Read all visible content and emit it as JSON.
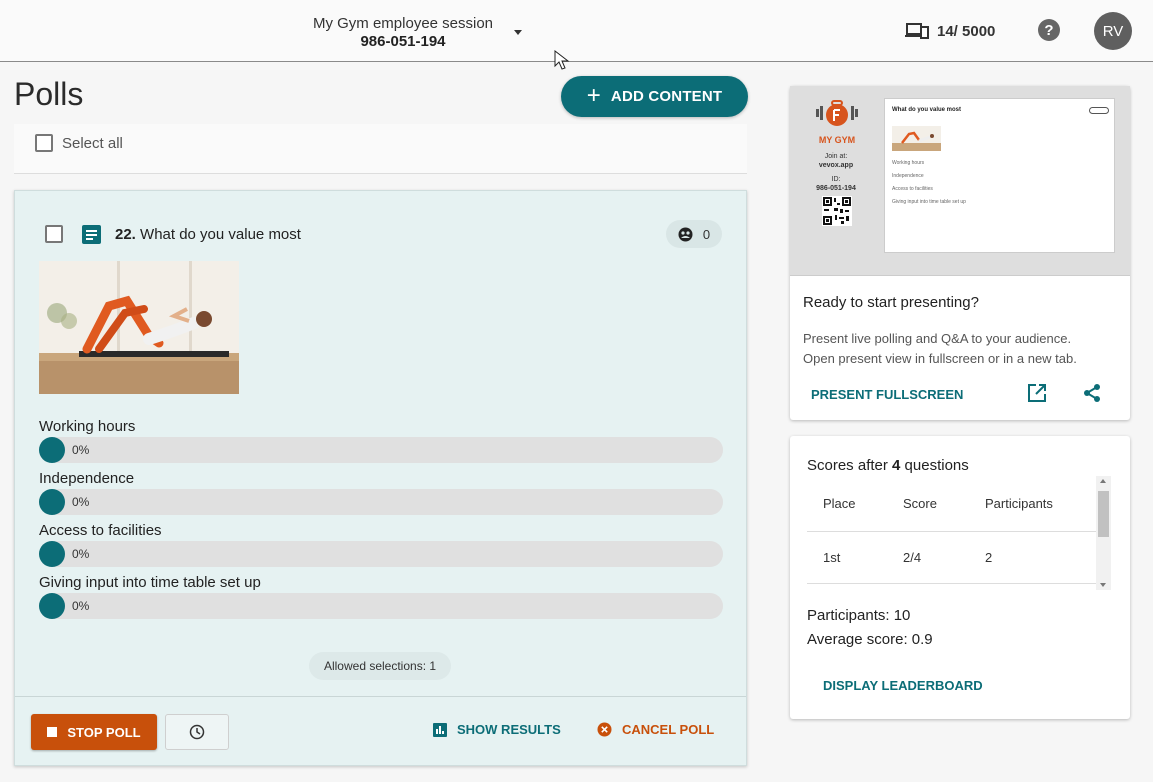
{
  "header": {
    "session_name": "My Gym employee session",
    "session_id": "986-051-194",
    "device_count": "14/ 5000",
    "help_label": "?",
    "avatar_initials": "RV"
  },
  "main": {
    "title": "Polls",
    "add_content_label": "ADD CONTENT",
    "select_all_label": "Select all"
  },
  "poll": {
    "number": "22.",
    "title": "What do you value most",
    "response_count": "0",
    "options": [
      {
        "label": "Working hours",
        "percent": "0%"
      },
      {
        "label": "Independence",
        "percent": "0%"
      },
      {
        "label": "Access to facilities",
        "percent": "0%"
      },
      {
        "label": "Giving input into time table set up",
        "percent": "0%"
      }
    ],
    "allowed_selections": "Allowed selections: 1",
    "stop_label": "STOP POLL",
    "show_results_label": "SHOW RESULTS",
    "cancel_label": "CANCEL POLL"
  },
  "preview": {
    "brand": "MY GYM",
    "join_at_label": "Join at:",
    "join_url": "vevox.app",
    "id_label": "ID:",
    "id_value": "986-051-194",
    "slide_title": "What do you value most",
    "slide_options": [
      "Working hours",
      "Independence",
      "Access to facilities",
      "Giving input into time table set up"
    ]
  },
  "present": {
    "title": "Ready to start presenting?",
    "desc_line1": "Present live polling and Q&A to your audience.",
    "desc_line2": "Open present view in fullscreen or in a new tab.",
    "fullscreen_label": "PRESENT FULLSCREEN"
  },
  "scores": {
    "title_prefix": "Scores after ",
    "question_count": "4",
    "title_suffix": " questions",
    "columns": [
      "Place",
      "Score",
      "Participants"
    ],
    "rows": [
      {
        "place": "1st",
        "score": "2/4",
        "participants": "2"
      }
    ],
    "participants_line": "Participants: 10",
    "average_line": "Average score: 0.9",
    "leaderboard_label": "DISPLAY LEADERBOARD"
  },
  "colors": {
    "accent": "#0c6d77",
    "danger": "#c8500b",
    "card_bg": "#e6f2f2"
  },
  "icons": [
    "chevron-down-icon",
    "devices-icon",
    "help-icon",
    "plus-icon",
    "poll-type-icon",
    "participants-icon",
    "stop-icon",
    "clock-icon",
    "bar-chart-icon",
    "cancel-icon",
    "open-in-new-icon",
    "share-icon"
  ]
}
